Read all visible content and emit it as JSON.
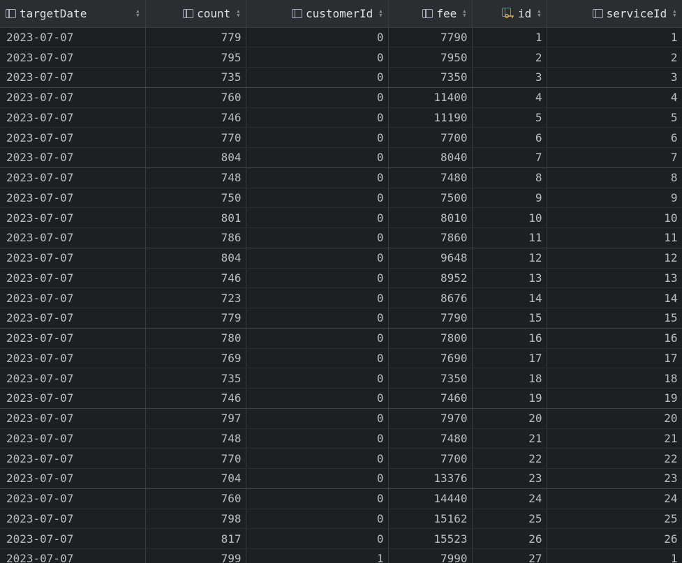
{
  "columns": [
    {
      "label": "targetDate",
      "icon": "column-icon",
      "align": "left"
    },
    {
      "label": "count",
      "icon": "column-icon",
      "align": "right"
    },
    {
      "label": "customerId",
      "icon": "column-icon",
      "align": "right"
    },
    {
      "label": "fee",
      "icon": "column-icon",
      "align": "right"
    },
    {
      "label": "id",
      "icon": "primary-key-column-icon",
      "align": "right"
    },
    {
      "label": "serviceId",
      "icon": "column-icon",
      "align": "right"
    }
  ],
  "sort_icon": "sort-arrows-icon",
  "rows": [
    [
      "2023-07-07",
      "779",
      "0",
      "7790",
      "1",
      "1"
    ],
    [
      "2023-07-07",
      "795",
      "0",
      "7950",
      "2",
      "2"
    ],
    [
      "2023-07-07",
      "735",
      "0",
      "7350",
      "3",
      "3"
    ],
    [
      "2023-07-07",
      "760",
      "0",
      "11400",
      "4",
      "4"
    ],
    [
      "2023-07-07",
      "746",
      "0",
      "11190",
      "5",
      "5"
    ],
    [
      "2023-07-07",
      "770",
      "0",
      "7700",
      "6",
      "6"
    ],
    [
      "2023-07-07",
      "804",
      "0",
      "8040",
      "7",
      "7"
    ],
    [
      "2023-07-07",
      "748",
      "0",
      "7480",
      "8",
      "8"
    ],
    [
      "2023-07-07",
      "750",
      "0",
      "7500",
      "9",
      "9"
    ],
    [
      "2023-07-07",
      "801",
      "0",
      "8010",
      "10",
      "10"
    ],
    [
      "2023-07-07",
      "786",
      "0",
      "7860",
      "11",
      "11"
    ],
    [
      "2023-07-07",
      "804",
      "0",
      "9648",
      "12",
      "12"
    ],
    [
      "2023-07-07",
      "746",
      "0",
      "8952",
      "13",
      "13"
    ],
    [
      "2023-07-07",
      "723",
      "0",
      "8676",
      "14",
      "14"
    ],
    [
      "2023-07-07",
      "779",
      "0",
      "7790",
      "15",
      "15"
    ],
    [
      "2023-07-07",
      "780",
      "0",
      "7800",
      "16",
      "16"
    ],
    [
      "2023-07-07",
      "769",
      "0",
      "7690",
      "17",
      "17"
    ],
    [
      "2023-07-07",
      "735",
      "0",
      "7350",
      "18",
      "18"
    ],
    [
      "2023-07-07",
      "746",
      "0",
      "7460",
      "19",
      "19"
    ],
    [
      "2023-07-07",
      "797",
      "0",
      "7970",
      "20",
      "20"
    ],
    [
      "2023-07-07",
      "748",
      "0",
      "7480",
      "21",
      "21"
    ],
    [
      "2023-07-07",
      "770",
      "0",
      "7700",
      "22",
      "22"
    ],
    [
      "2023-07-07",
      "704",
      "0",
      "13376",
      "23",
      "23"
    ],
    [
      "2023-07-07",
      "760",
      "0",
      "14440",
      "24",
      "24"
    ],
    [
      "2023-07-07",
      "798",
      "0",
      "15162",
      "25",
      "25"
    ],
    [
      "2023-07-07",
      "817",
      "0",
      "15523",
      "26",
      "26"
    ],
    [
      "2023-07-07",
      "799",
      "1",
      "7990",
      "27",
      "1"
    ]
  ]
}
